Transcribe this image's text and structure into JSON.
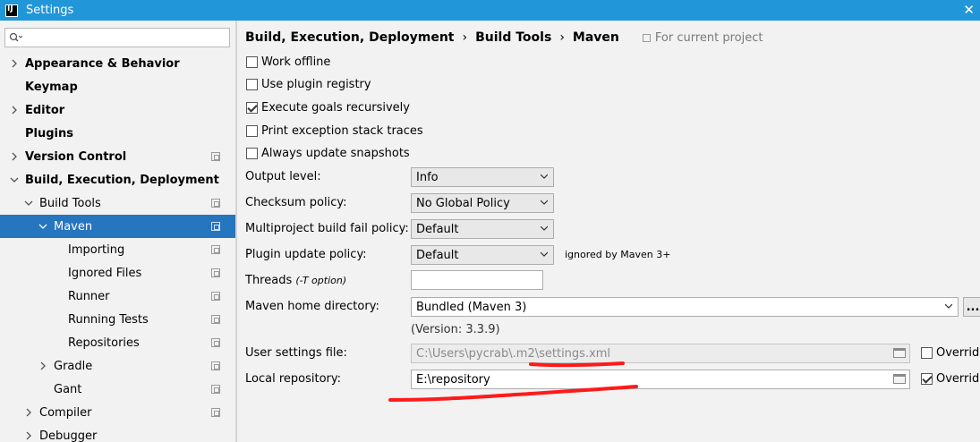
{
  "window": {
    "app_icon": "IJ",
    "title": "Settings",
    "close": "✕"
  },
  "sidebar": {
    "search_icon": "search-icon",
    "search_placeholder": "",
    "items": [
      {
        "label": "Appearance & Behavior",
        "bold": true,
        "expanded": false,
        "has_arrow": true
      },
      {
        "label": "Keymap",
        "bold": true,
        "has_arrow": false
      },
      {
        "label": "Editor",
        "bold": true,
        "expanded": false,
        "has_arrow": true
      },
      {
        "label": "Plugins",
        "bold": true,
        "has_arrow": false
      },
      {
        "label": "Version Control",
        "bold": true,
        "expanded": false,
        "has_arrow": true,
        "project_icon": true
      },
      {
        "label": "Build, Execution, Deployment",
        "bold": true,
        "expanded": true,
        "has_arrow": true
      },
      {
        "label": "Build Tools",
        "bold": false,
        "expanded": true,
        "has_arrow": true,
        "project_icon": true
      },
      {
        "label": "Maven",
        "bold": false,
        "expanded": true,
        "has_arrow": true,
        "project_icon": true,
        "selected": true
      },
      {
        "label": "Importing",
        "project_icon": true
      },
      {
        "label": "Ignored Files",
        "project_icon": true
      },
      {
        "label": "Runner",
        "project_icon": true
      },
      {
        "label": "Running Tests",
        "project_icon": true
      },
      {
        "label": "Repositories",
        "project_icon": true
      },
      {
        "label": "Gradle",
        "expanded": false,
        "has_arrow": true,
        "project_icon": true
      },
      {
        "label": "Gant",
        "project_icon": true
      },
      {
        "label": "Compiler",
        "expanded": false,
        "has_arrow": true,
        "project_icon": true
      },
      {
        "label": "Debugger",
        "expanded": false,
        "has_arrow": true
      }
    ]
  },
  "breadcrumb": {
    "items": [
      "Build, Execution, Deployment",
      "Build Tools",
      "Maven"
    ],
    "separator": "›",
    "scope": "For current project"
  },
  "options": {
    "work_offline": {
      "label": "Work offline",
      "checked": false
    },
    "plugin_registry": {
      "label": "Use plugin registry",
      "checked": false
    },
    "execute_recursively": {
      "label": "Execute goals recursively",
      "checked": true
    },
    "print_exceptions": {
      "label": "Print exception stack traces",
      "checked": false
    },
    "update_snapshots": {
      "label": "Always update snapshots",
      "checked": false
    }
  },
  "form": {
    "output_level": {
      "label": "Output level:",
      "value": "Info"
    },
    "checksum_policy": {
      "label": "Checksum policy:",
      "value": "No Global Policy"
    },
    "multiproject_policy": {
      "label": "Multiproject build fail policy:",
      "value": "Default"
    },
    "plugin_update_policy": {
      "label": "Plugin update policy:",
      "value": "Default",
      "note": "ignored by Maven 3+"
    },
    "threads": {
      "label": "Threads",
      "hint": "(-T option)",
      "value": ""
    },
    "maven_home": {
      "label": "Maven home directory:",
      "value": "Bundled (Maven 3)",
      "more": "...",
      "version": "(Version: 3.3.9)"
    },
    "user_settings": {
      "label": "User settings file:",
      "value": "C:\\Users\\pycrab\\.m2\\settings.xml",
      "override_label": "Override",
      "override_checked": false
    },
    "local_repo": {
      "label": "Local repository:",
      "value": "E:\\repository",
      "override_label": "Override",
      "override_checked": true
    }
  },
  "colors": {
    "titlebar": "#2196d9",
    "selection": "#2675bf",
    "annotation": "#ff1a1a"
  }
}
